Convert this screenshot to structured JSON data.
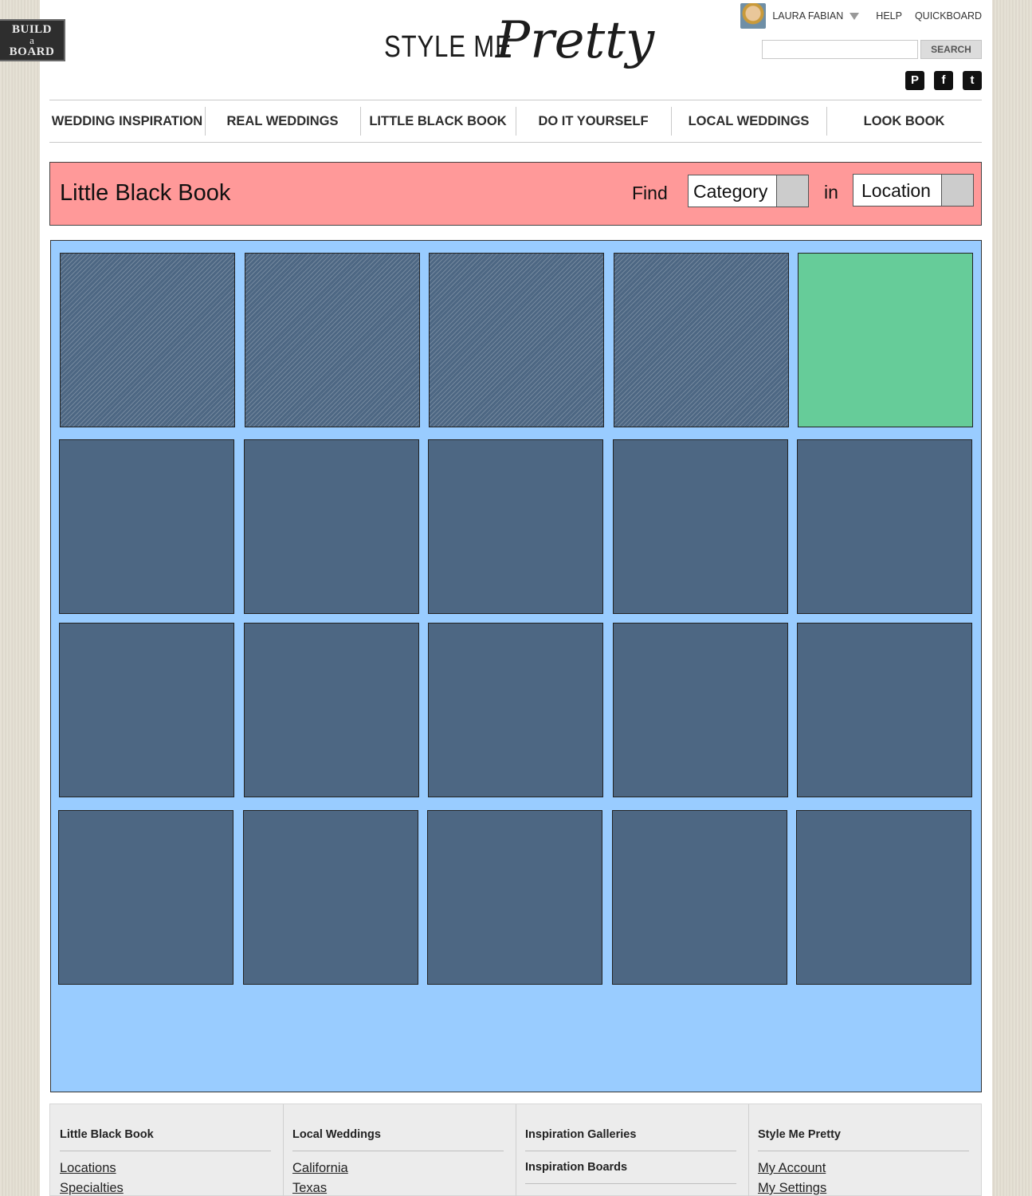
{
  "badge": {
    "line1": "BUILD",
    "line2": "a",
    "line3": "BOARD"
  },
  "logo": {
    "text": "STYLE ME",
    "script": "Pretty"
  },
  "user": {
    "name": "LAURA FABIAN",
    "help": "HELP",
    "quickboard": "QUICKBOARD"
  },
  "search": {
    "button": "SEARCH",
    "value": ""
  },
  "social": [
    "pinterest-icon",
    "facebook-icon",
    "twitter-icon"
  ],
  "nav": [
    "WEDDING INSPIRATION",
    "REAL WEDDINGS",
    "LITTLE BLACK BOOK",
    "DO IT YOURSELF",
    "LOCAL WEDDINGS",
    "LOOK BOOK"
  ],
  "lbb": {
    "title": "Little Black Book",
    "find": "Find",
    "category": "Category",
    "in": "in",
    "location": "Location"
  },
  "colors": {
    "header_bar": "#ff9999",
    "grid_bg": "#99ccff",
    "tile": "#4d6783",
    "promo_tile": "#66cc99"
  },
  "footer": [
    {
      "heading": "Little Black Book",
      "links": [
        "Locations",
        "Specialties"
      ]
    },
    {
      "heading": "Local Weddings",
      "links": [
        "California",
        "Texas"
      ]
    },
    {
      "heading": "Inspiration Galleries",
      "links": [],
      "heading2": "Inspiration Boards"
    },
    {
      "heading": "Style Me Pretty",
      "links": [
        "My Account",
        "My Settings"
      ]
    }
  ]
}
